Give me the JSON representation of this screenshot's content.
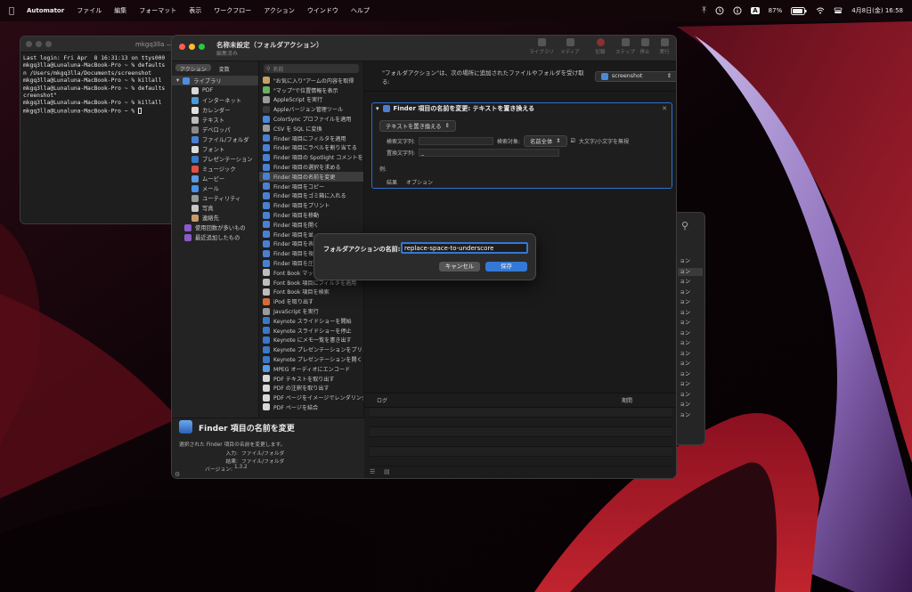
{
  "menubar": {
    "app_name": "Automator",
    "menus": [
      "ファイル",
      "編集",
      "フォーマット",
      "表示",
      "ワークフロー",
      "アクション",
      "ウインドウ",
      "ヘルプ"
    ],
    "battery": "87%",
    "datetime": "4月8日(金) 16:58"
  },
  "terminal": {
    "title": "mkgq3lla — -z",
    "lines": [
      "Last login: Fri Apr  8 16:31:13 on ttys000",
      "mkgq3lla@Lunaluna-MacBook-Pro ~ % defaults",
      "n /Users/mkgq3lla/Documents/screenshot",
      "mkgq3lla@Lunaluna-MacBook-Pro ~ % killall",
      "mkgq3lla@Lunaluna-MacBook-Pro ~ % defaults",
      "creenshot\"",
      "mkgq3lla@Lunaluna-MacBook-Pro ~ % killall",
      "mkgq3lla@Lunaluna-MacBook-Pro ~ % "
    ]
  },
  "automator": {
    "title": "名称未設定（フォルダアクション）",
    "subtitle": "編集済み",
    "toolbar": [
      "ライブラリ",
      "メディア",
      "記録",
      "ステップ",
      "停止",
      "実行"
    ],
    "tab_actions": "アクション",
    "tab_variables": "変数",
    "search_placeholder": "名前",
    "library": [
      {
        "label": "ライブラリ",
        "color": "#4a8fe0"
      },
      {
        "label": "PDF",
        "color": "#d8d8d8"
      },
      {
        "label": "インターネット",
        "color": "#4a9ad8"
      },
      {
        "label": "カレンダー",
        "color": "#e0e0e0"
      },
      {
        "label": "テキスト",
        "color": "#bcbcbc"
      },
      {
        "label": "デベロッパ",
        "color": "#8a8a8a"
      },
      {
        "label": "ファイル/フォルダ",
        "color": "#4a80d0"
      },
      {
        "label": "フォント",
        "color": "#dcdcdc"
      },
      {
        "label": "プレゼンテーション",
        "color": "#3a78c8"
      },
      {
        "label": "ミュージック",
        "color": "#e0504a"
      },
      {
        "label": "ムービー",
        "color": "#5a9ae0"
      },
      {
        "label": "メール",
        "color": "#4a90e8"
      },
      {
        "label": "ユーティリティ",
        "color": "#9a9a9a"
      },
      {
        "label": "写真",
        "color": "#c8c8c8"
      },
      {
        "label": "連絡先",
        "color": "#c89a6a"
      },
      {
        "label": "使用回数が多いもの",
        "color": "#8a5ac8"
      },
      {
        "label": "最近追加したもの",
        "color": "#8a5ac8"
      }
    ],
    "actions": [
      {
        "label": "\"お気に入り\"アームの内容を取得",
        "color": "#c8a060"
      },
      {
        "label": "\"マップ\"で位置情報を表示",
        "color": "#6ab060"
      },
      {
        "label": "AppleScript を実行",
        "color": "#9a9a9a"
      },
      {
        "label": "Appleバージョン管理ツール",
        "color": "#3a3a3a"
      },
      {
        "label": "ColorSync プロファイルを適用",
        "color": "#4a88d8"
      },
      {
        "label": "CSV を SQL に変換",
        "color": "#9a9a9a"
      },
      {
        "label": "Finder 項目にフィルタを適用",
        "color": "#4a80d0"
      },
      {
        "label": "Finder 項目にラベルを割り当てる",
        "color": "#4a80d0"
      },
      {
        "label": "Finder 項目の Spotlight コメントを設定",
        "color": "#4a80d0"
      },
      {
        "label": "Finder 項目の選択を求める",
        "color": "#4a80d0"
      },
      {
        "label": "Finder 項目の名前を変更",
        "color": "#4a80d0"
      },
      {
        "label": "Finder 項目をコピー",
        "color": "#4a80d0"
      },
      {
        "label": "Finder 項目をゴミ箱に入れる",
        "color": "#4a80d0"
      },
      {
        "label": "Finder 項目をプリント",
        "color": "#4a80d0"
      },
      {
        "label": "Finder 項目を移動",
        "color": "#4a80d0"
      },
      {
        "label": "Finder 項目を開く",
        "color": "#4a80d0"
      },
      {
        "label": "Finder 項目を並",
        "color": "#4a80d0"
      },
      {
        "label": "Finder 項目を表",
        "color": "#4a80d0"
      },
      {
        "label": "Finder 項目を複",
        "color": "#4a80d0"
      },
      {
        "label": "Finder 項目を圧",
        "color": "#4a80d0"
      },
      {
        "label": "Font Book マッ",
        "color": "#bcbcbc"
      },
      {
        "label": "Font Book 項目にフィルタを適用",
        "color": "#bcbcbc"
      },
      {
        "label": "Font Book 項目を検索",
        "color": "#bcbcbc"
      },
      {
        "label": "iPod を取り出す",
        "color": "#d86a3a"
      },
      {
        "label": "JavaScript を実行",
        "color": "#9a9a9a"
      },
      {
        "label": "Keynote スライドショーを開始",
        "color": "#3a78c8"
      },
      {
        "label": "Keynote スライドショーを停止",
        "color": "#3a78c8"
      },
      {
        "label": "Keynote にメモ一覧を書き出す",
        "color": "#3a78c8"
      },
      {
        "label": "Keynote プレゼンテーションをプリント",
        "color": "#3a78c8"
      },
      {
        "label": "Keynote プレゼンテーションを開く",
        "color": "#3a78c8"
      },
      {
        "label": "MPEG オーディオにエンコード",
        "color": "#5a9ae0"
      },
      {
        "label": "PDF テキストを取り出す",
        "color": "#d8d8d8"
      },
      {
        "label": "PDF の注釈を取り出す",
        "color": "#d8d8d8"
      },
      {
        "label": "PDF ページをイメージでレンダリング",
        "color": "#d8d8d8"
      },
      {
        "label": "PDF ページを結合",
        "color": "#d8d8d8"
      }
    ],
    "workflow_header_text": "\"フォルダアクション\"は、次の場所に追加されたファイルやフォルダを受け取る:",
    "target_folder": "screenshot",
    "action_box": {
      "title": "Finder 項目の名前を変更: テキストを置き換える",
      "mode": "テキストを置き換える",
      "find_label": "検索文字列:",
      "search_in_label": "検索対象:",
      "search_in_value": "名前全体",
      "ignore_case": "大文字/小文字を無視",
      "replace_label": "置換文字列:",
      "replace_value": "_",
      "example_label": "例:",
      "tab_result": "結果",
      "tab_options": "オプション"
    },
    "log_col": "ログ",
    "time_col": "期間",
    "description": {
      "title": "Finder 項目の名前を変更",
      "text": "選択された Finder 項目の名前を変更します。",
      "input_label": "入力:",
      "input_value": "ファイル/フォルダ",
      "output_label": "結果:",
      "output_value": "ファイル/フォルダ",
      "version_label": "バージョン:",
      "version_value": "1.3.2"
    }
  },
  "dialog": {
    "label": "フォルダアクションの名前:",
    "value": "replace-space-to-underscore",
    "cancel": "キャンセル",
    "save": "保存"
  },
  "rightwin": {
    "items": [
      "ョン",
      "ョン",
      "ョン",
      "ョン",
      "ョン",
      "ョン",
      "ョン",
      "ョン",
      "ョン",
      "ョン",
      "ョン",
      "ョン",
      "ョン",
      "ョン",
      "ョン",
      "ョン"
    ]
  }
}
